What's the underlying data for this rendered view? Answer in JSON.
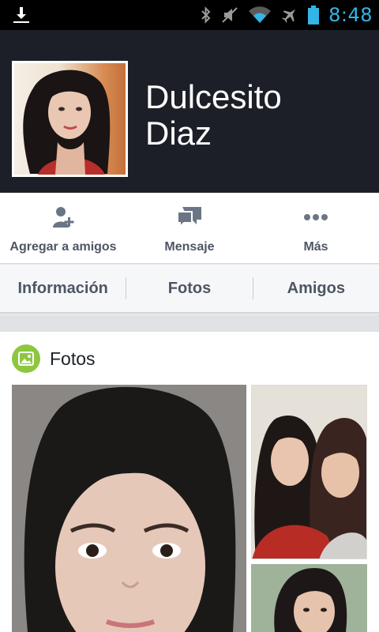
{
  "status_bar": {
    "time": "8:48",
    "icons": [
      "download-icon",
      "bluetooth-icon",
      "mute-icon",
      "wifi-icon",
      "airplane-icon",
      "battery-icon"
    ],
    "time_color": "#33b5e5"
  },
  "profile": {
    "name_line1": "Dulcesito",
    "name_line2": "Diaz",
    "header_bg": "#1c1f27"
  },
  "actions": [
    {
      "label": "Agregar a amigos",
      "icon": "add-friend-icon"
    },
    {
      "label": "Mensaje",
      "icon": "message-icon"
    },
    {
      "label": "Más",
      "icon": "more-icon"
    }
  ],
  "tabs": [
    {
      "label": "Información"
    },
    {
      "label": "Fotos"
    },
    {
      "label": "Amigos"
    }
  ],
  "photos_card": {
    "title": "Fotos",
    "icon": "photo-icon",
    "badge_color": "#8dc63f"
  }
}
